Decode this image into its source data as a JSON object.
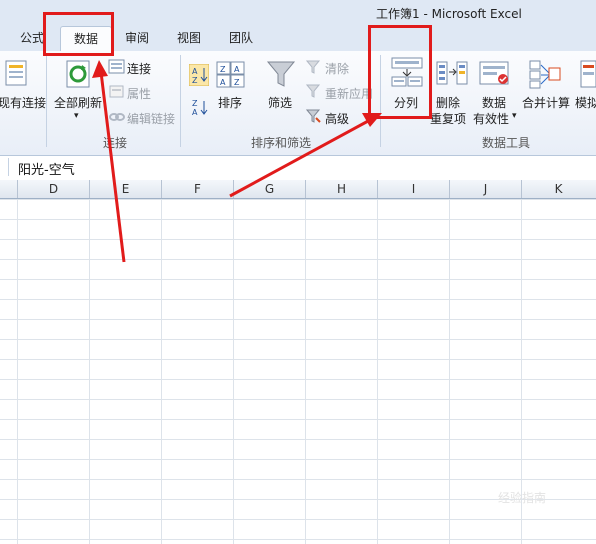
{
  "window": {
    "title": "工作簿1 - Microsoft Excel"
  },
  "tabs": [
    {
      "label": "公式"
    },
    {
      "label": "数据"
    },
    {
      "label": "审阅"
    },
    {
      "label": "视图"
    },
    {
      "label": "团队"
    }
  ],
  "ribbon": {
    "existing_connections": "现有连接",
    "refresh_all": "全部刷新",
    "connections": "连接",
    "properties": "属性",
    "edit_links": "编辑链接",
    "group_connections": "连接",
    "sort_asc_icon": "sort-asc-icon",
    "sort_desc_icon": "sort-desc-icon",
    "sort": "排序",
    "filter": "筛选",
    "clear": "清除",
    "reapply": "重新应用",
    "advanced": "高级",
    "group_sort_filter": "排序和筛选",
    "text_to_columns": "分列",
    "remove_dup_line1": "删除",
    "remove_dup_line2": "重复项",
    "data_validation_line1": "数据",
    "data_validation_line2": "有效性",
    "consolidate": "合并计算",
    "what_if": "模拟",
    "group_data_tools": "数据工具"
  },
  "formula_bar": {
    "content": "阳光-空气"
  },
  "columns": [
    "D",
    "E",
    "F",
    "G",
    "H",
    "I",
    "J",
    "K"
  ],
  "annotations": {
    "highlight_color": "#e11b1b"
  },
  "watermark": "经验指南"
}
